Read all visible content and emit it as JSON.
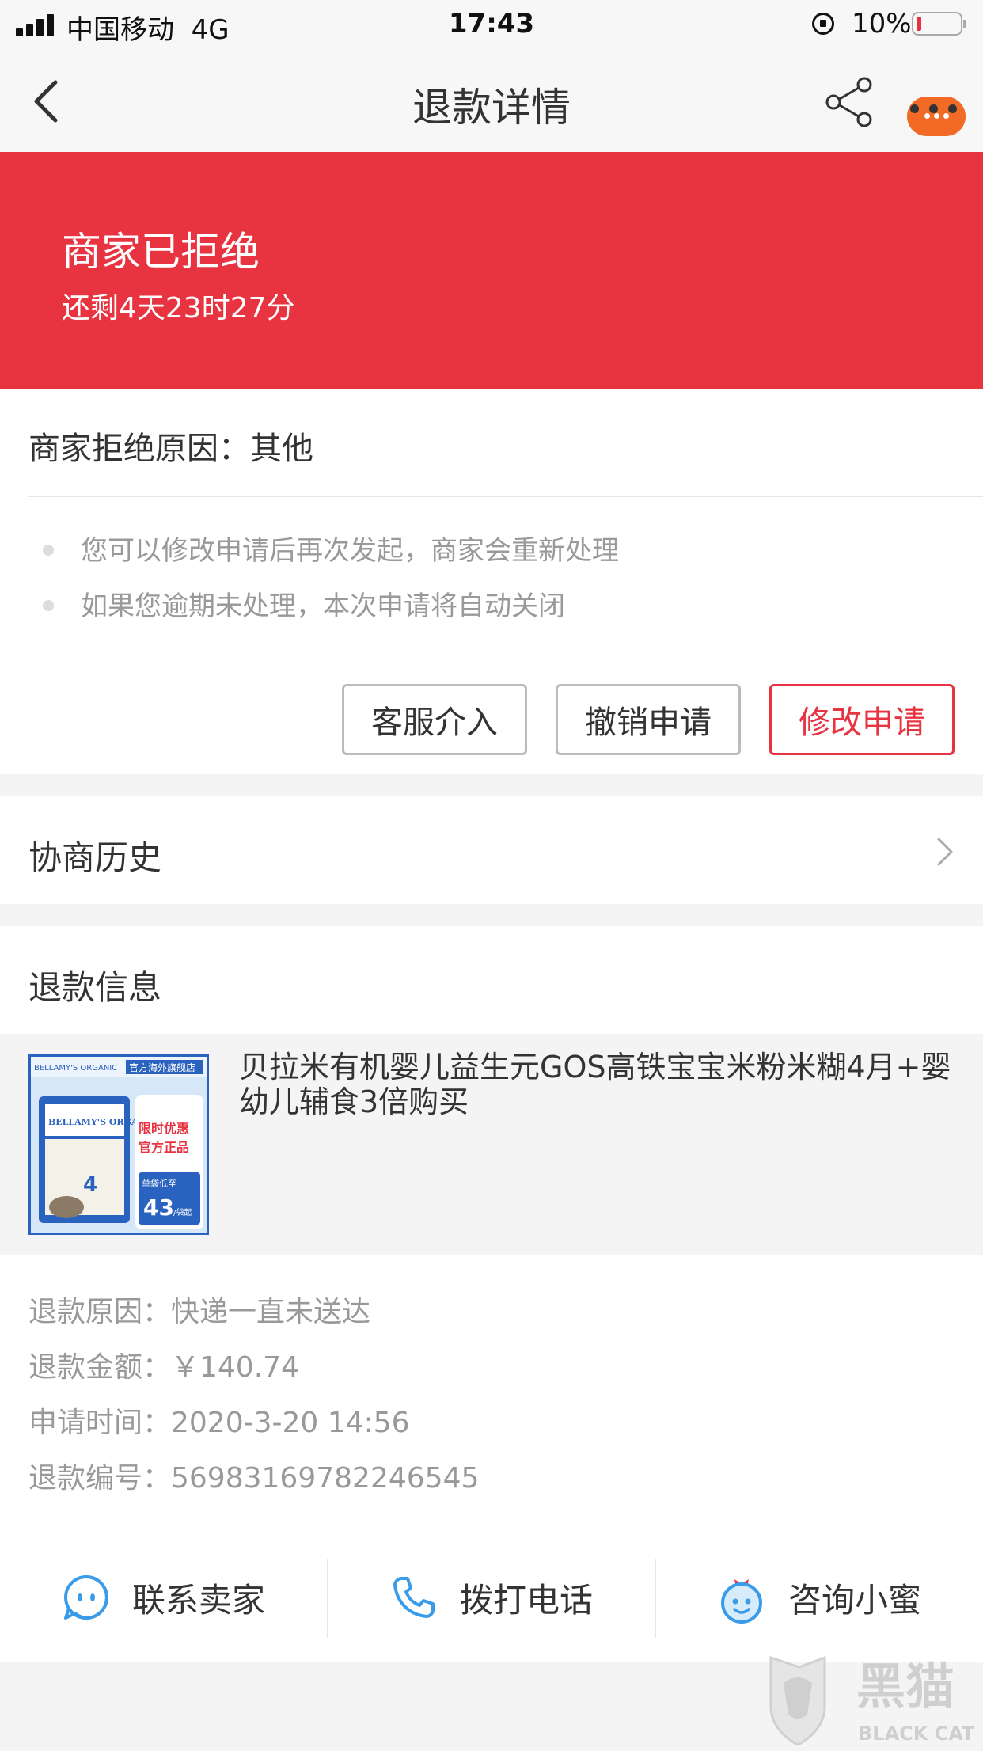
{
  "status_bar": {
    "carrier": "中国移动",
    "network": "4G",
    "time": "17:43",
    "battery": "10%"
  },
  "nav": {
    "title": "退款详情",
    "back_icon": "chevron-left-icon",
    "share_icon": "share-icon",
    "more_icon": "more-dots-icon"
  },
  "banner": {
    "status": "商家已拒绝",
    "countdown": "还剩4天23时27分",
    "color": "#e83341"
  },
  "reject": {
    "reason": "商家拒绝原因：其他",
    "tips": [
      "您可以修改申请后再次发起，商家会重新处理",
      "如果您逾期未处理，本次申请将自动关闭"
    ],
    "buttons": {
      "service": "客服介入",
      "revoke": "撤销申请",
      "modify": "修改申请"
    }
  },
  "history": {
    "label": "协商历史"
  },
  "refund_info": {
    "title": "退款信息",
    "product": {
      "title": "贝拉米有机婴儿益生元GOS高铁宝宝米粉米糊4月+婴幼儿辅食3倍购买",
      "image_text": {
        "store": "官方海外旗舰店",
        "brand": "BELLAMY'S ORGANIC",
        "promo1": "限时优惠",
        "promo2": "官方正品",
        "price_label": "单袋低至",
        "price": "43",
        "price_unit": "/袋起"
      }
    },
    "rows": [
      "退款原因：快递一直未送达",
      "退款金额：￥140.74",
      "申请时间：2020-3-20 14:56",
      "退款编号：56983169782246545"
    ]
  },
  "actions": [
    {
      "label": "联系卖家",
      "icon": "chat-face-icon"
    },
    {
      "label": "拨打电话",
      "icon": "phone-icon"
    },
    {
      "label": "咨询小蜜",
      "icon": "assistant-face-icon"
    }
  ],
  "watermark": {
    "cn": "黑猫",
    "en": "BLACK CAT"
  },
  "colors": {
    "accent_red": "#e83341",
    "icon_blue": "#3a9be8",
    "badge_orange": "#f26a25"
  }
}
